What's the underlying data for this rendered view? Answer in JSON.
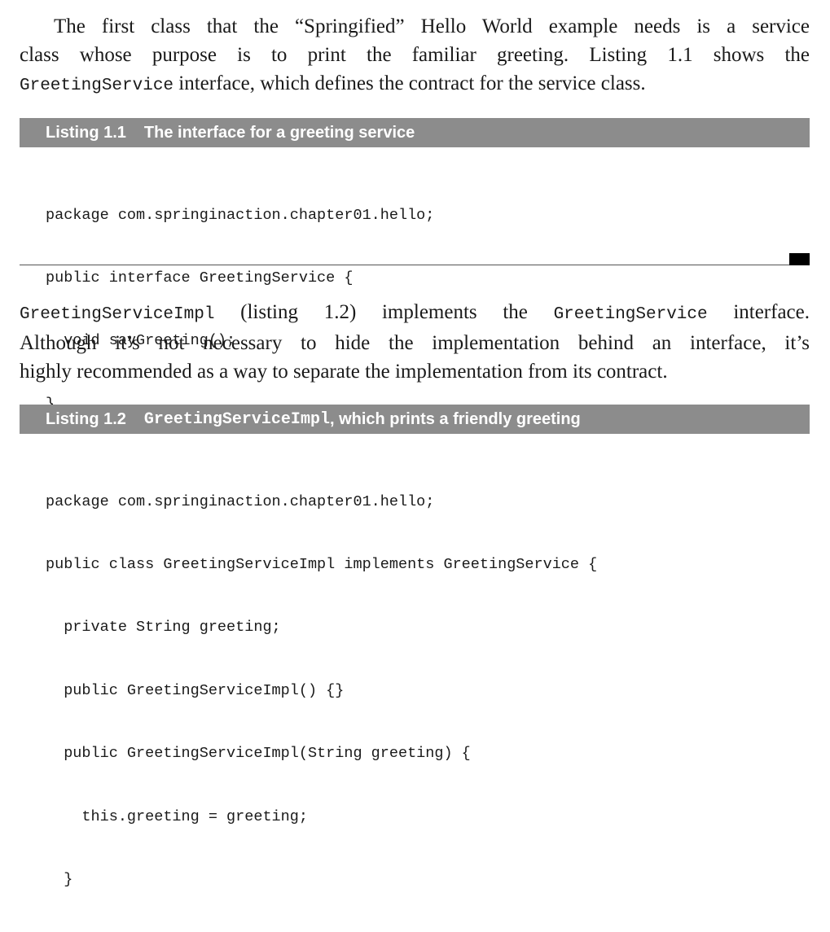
{
  "paragraph1": {
    "line1": "The first class that the “Springified” Hello World example needs is a service",
    "line2": "class whose purpose is to print the familiar greeting. Listing 1.1 shows the",
    "line3_code": "GreetingService",
    "line3_text": " interface, which defines the contract for the service class."
  },
  "listing1": {
    "number": "Listing 1.1",
    "title": "The interface for a greeting service",
    "code": [
      "package com.springinaction.chapter01.hello;",
      "public interface GreetingService {",
      "  void sayGreeting();",
      "}"
    ]
  },
  "paragraph2": {
    "line1_code_a": "GreetingServiceImpl",
    "line1_text_a": " (listing 1.2) implements the ",
    "line1_code_b": "GreetingService",
    "line1_text_b": " interface.",
    "line2": "Although it’s not necessary to hide the implementation behind an interface, it’s",
    "line3": "highly recommended as a way to separate the implementation from its contract."
  },
  "listing2": {
    "number": "Listing 1.2",
    "title_code": "GreetingServiceImpl",
    "title_text": ", which prints a friendly greeting",
    "code": [
      "package com.springinaction.chapter01.hello;",
      "public class GreetingServiceImpl implements GreetingService {",
      "  private String greeting;",
      "  public GreetingServiceImpl() {}",
      "  public GreetingServiceImpl(String greeting) {",
      "    this.greeting = greeting;",
      "  }"
    ]
  }
}
